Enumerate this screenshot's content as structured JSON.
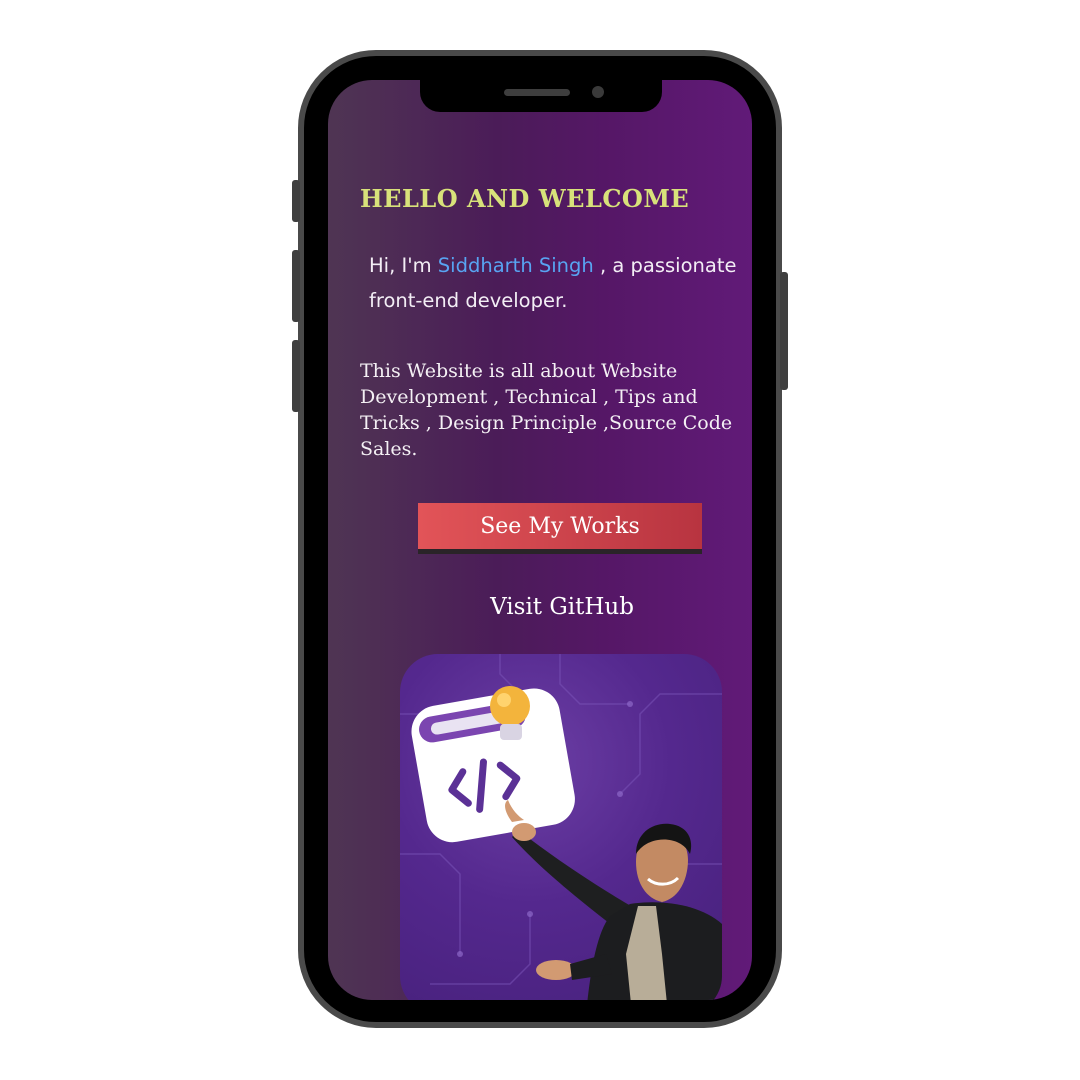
{
  "welcome": {
    "title": "HELLO AND WELCOME",
    "intro_prefix": "Hi, I'm ",
    "name": "Siddharth Singh",
    "intro_suffix": " , a passionate front-end developer.",
    "description": "This Website is all about Website Development , Technical , Tips and Tricks , Design Principle ,Source Code Sales."
  },
  "actions": {
    "works_label": "See My Works",
    "github_label": "Visit GitHub"
  },
  "hero": {
    "illustration": "code-window-with-lightbulb-icon",
    "person": "developer-presenting-photo"
  },
  "colors": {
    "title": "#d8e27a",
    "name_link": "#58a4f2",
    "button": "#d94a4f",
    "background": "#551766"
  }
}
